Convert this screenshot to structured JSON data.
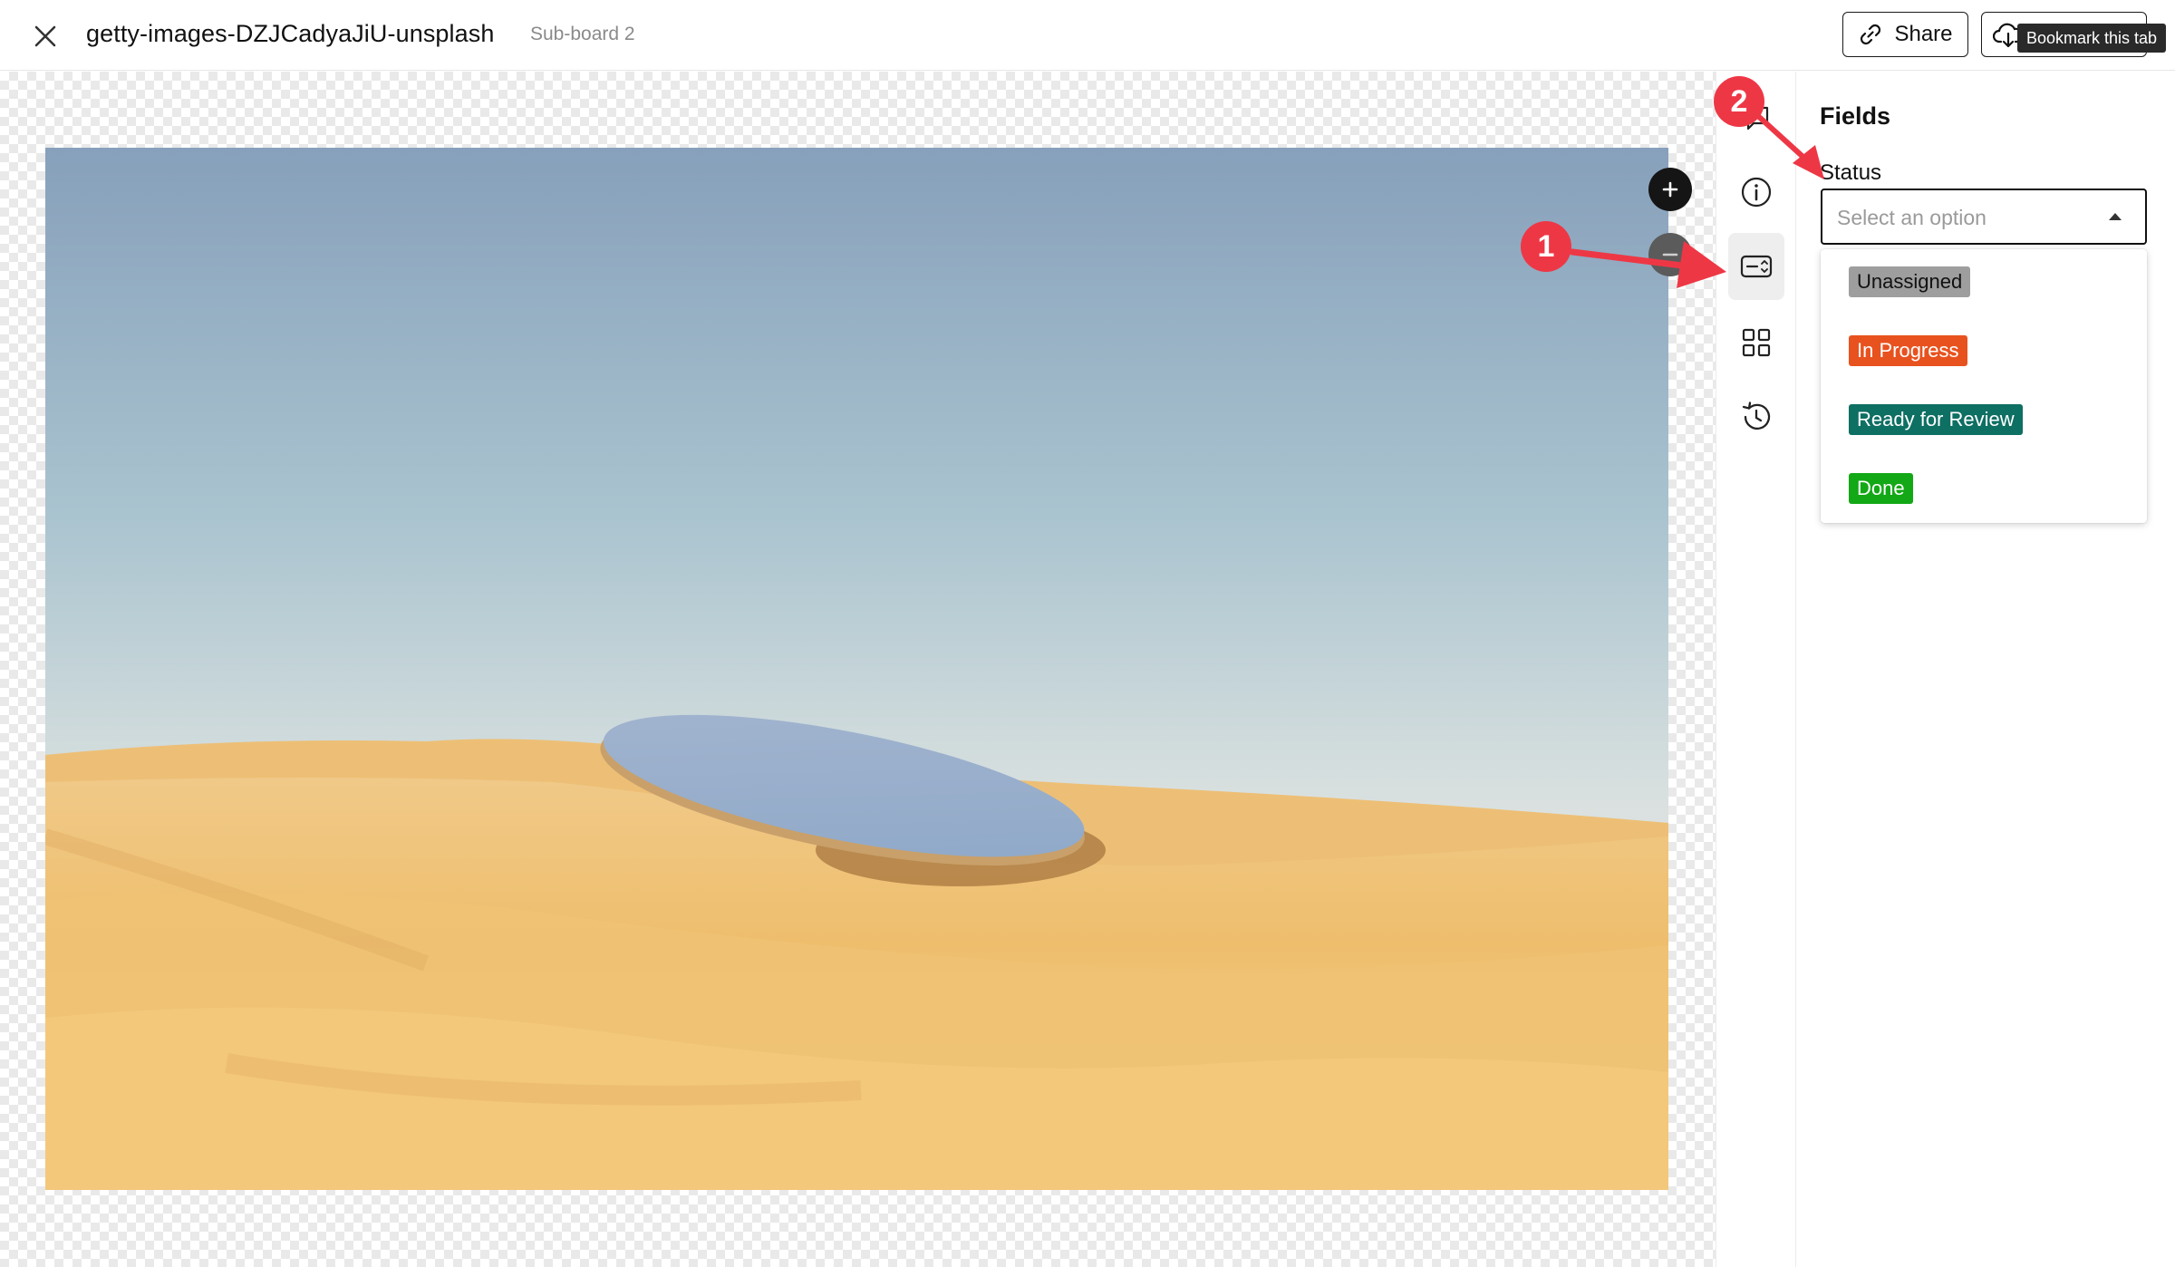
{
  "header": {
    "title": "getty-images-DZJCadyaJiU-unsplash",
    "subtitle": "Sub-board 2",
    "share_label": "Share",
    "tooltip": "Bookmark this tab",
    "icons": {
      "close": "close-icon",
      "share": "link-icon",
      "download": "cloud-download-icon"
    }
  },
  "canvas": {
    "zoom_in_label": "+",
    "zoom_out_label": "−",
    "image_description_icon": "desert-mirror-photo"
  },
  "rail": {
    "items": [
      {
        "icon": "comment-icon"
      },
      {
        "icon": "info-icon"
      },
      {
        "icon": "fields-icon",
        "active": true
      },
      {
        "icon": "grid-icon"
      },
      {
        "icon": "history-icon"
      }
    ]
  },
  "panel": {
    "title": "Fields",
    "status_label": "Status",
    "select_placeholder": "Select an option",
    "options": [
      {
        "label": "Unassigned",
        "bg": "#9e9e9e",
        "fg": "#111111"
      },
      {
        "label": "In Progress",
        "bg": "#e8521f",
        "fg": "#ffffff"
      },
      {
        "label": "Ready for Review",
        "bg": "#0e6f63",
        "fg": "#ffffff"
      },
      {
        "label": "Done",
        "bg": "#13a816",
        "fg": "#ffffff"
      }
    ]
  },
  "annotations": {
    "badge_1": "1",
    "badge_2": "2",
    "color": "#ee3745"
  }
}
